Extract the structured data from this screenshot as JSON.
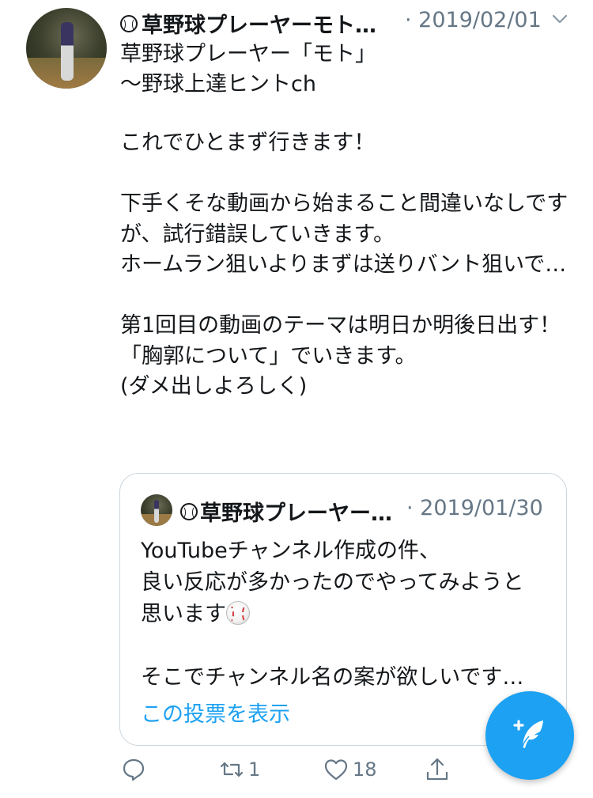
{
  "tweet": {
    "author_header": "草野球プレーヤーモト…",
    "timestamp": "· 2019/02/01",
    "display_name": "草野球プレーヤー「モト」\n〜野球上達ヒントch",
    "body": "これでひとまず行きます！\n\n下手くそな動画から始まること間違いなしですが、試行錯誤していきます。\nホームラン狙いよりまずは送りバント狙いで…\n\n第1回目の動画のテーマは明日か明後日出す！\n「胸郭について」でいきます。\n(ダメ出しよろしく)"
  },
  "quote": {
    "author": "草野球プレーヤー…",
    "timestamp": "· 2019/01/30",
    "body_line1": "YouTubeチャンネル作成の件、",
    "body_line2": "良い反応が多かったのでやってみようと",
    "body_line3": "思います",
    "body_line4": "そこでチャンネル名の案が欲しいです…",
    "poll_link": "この投票を表示"
  },
  "actions": {
    "reply_icon": "reply-icon",
    "retweet_icon": "retweet-icon",
    "retweet_count": "1",
    "like_icon": "heart-icon",
    "like_count": "18",
    "share_icon": "share-icon"
  },
  "compose_button": {
    "icon": "compose-feather-icon"
  },
  "colors": {
    "accent": "#1da1f2",
    "muted": "#657786",
    "text": "#14171a",
    "border": "#ccd6dd"
  }
}
